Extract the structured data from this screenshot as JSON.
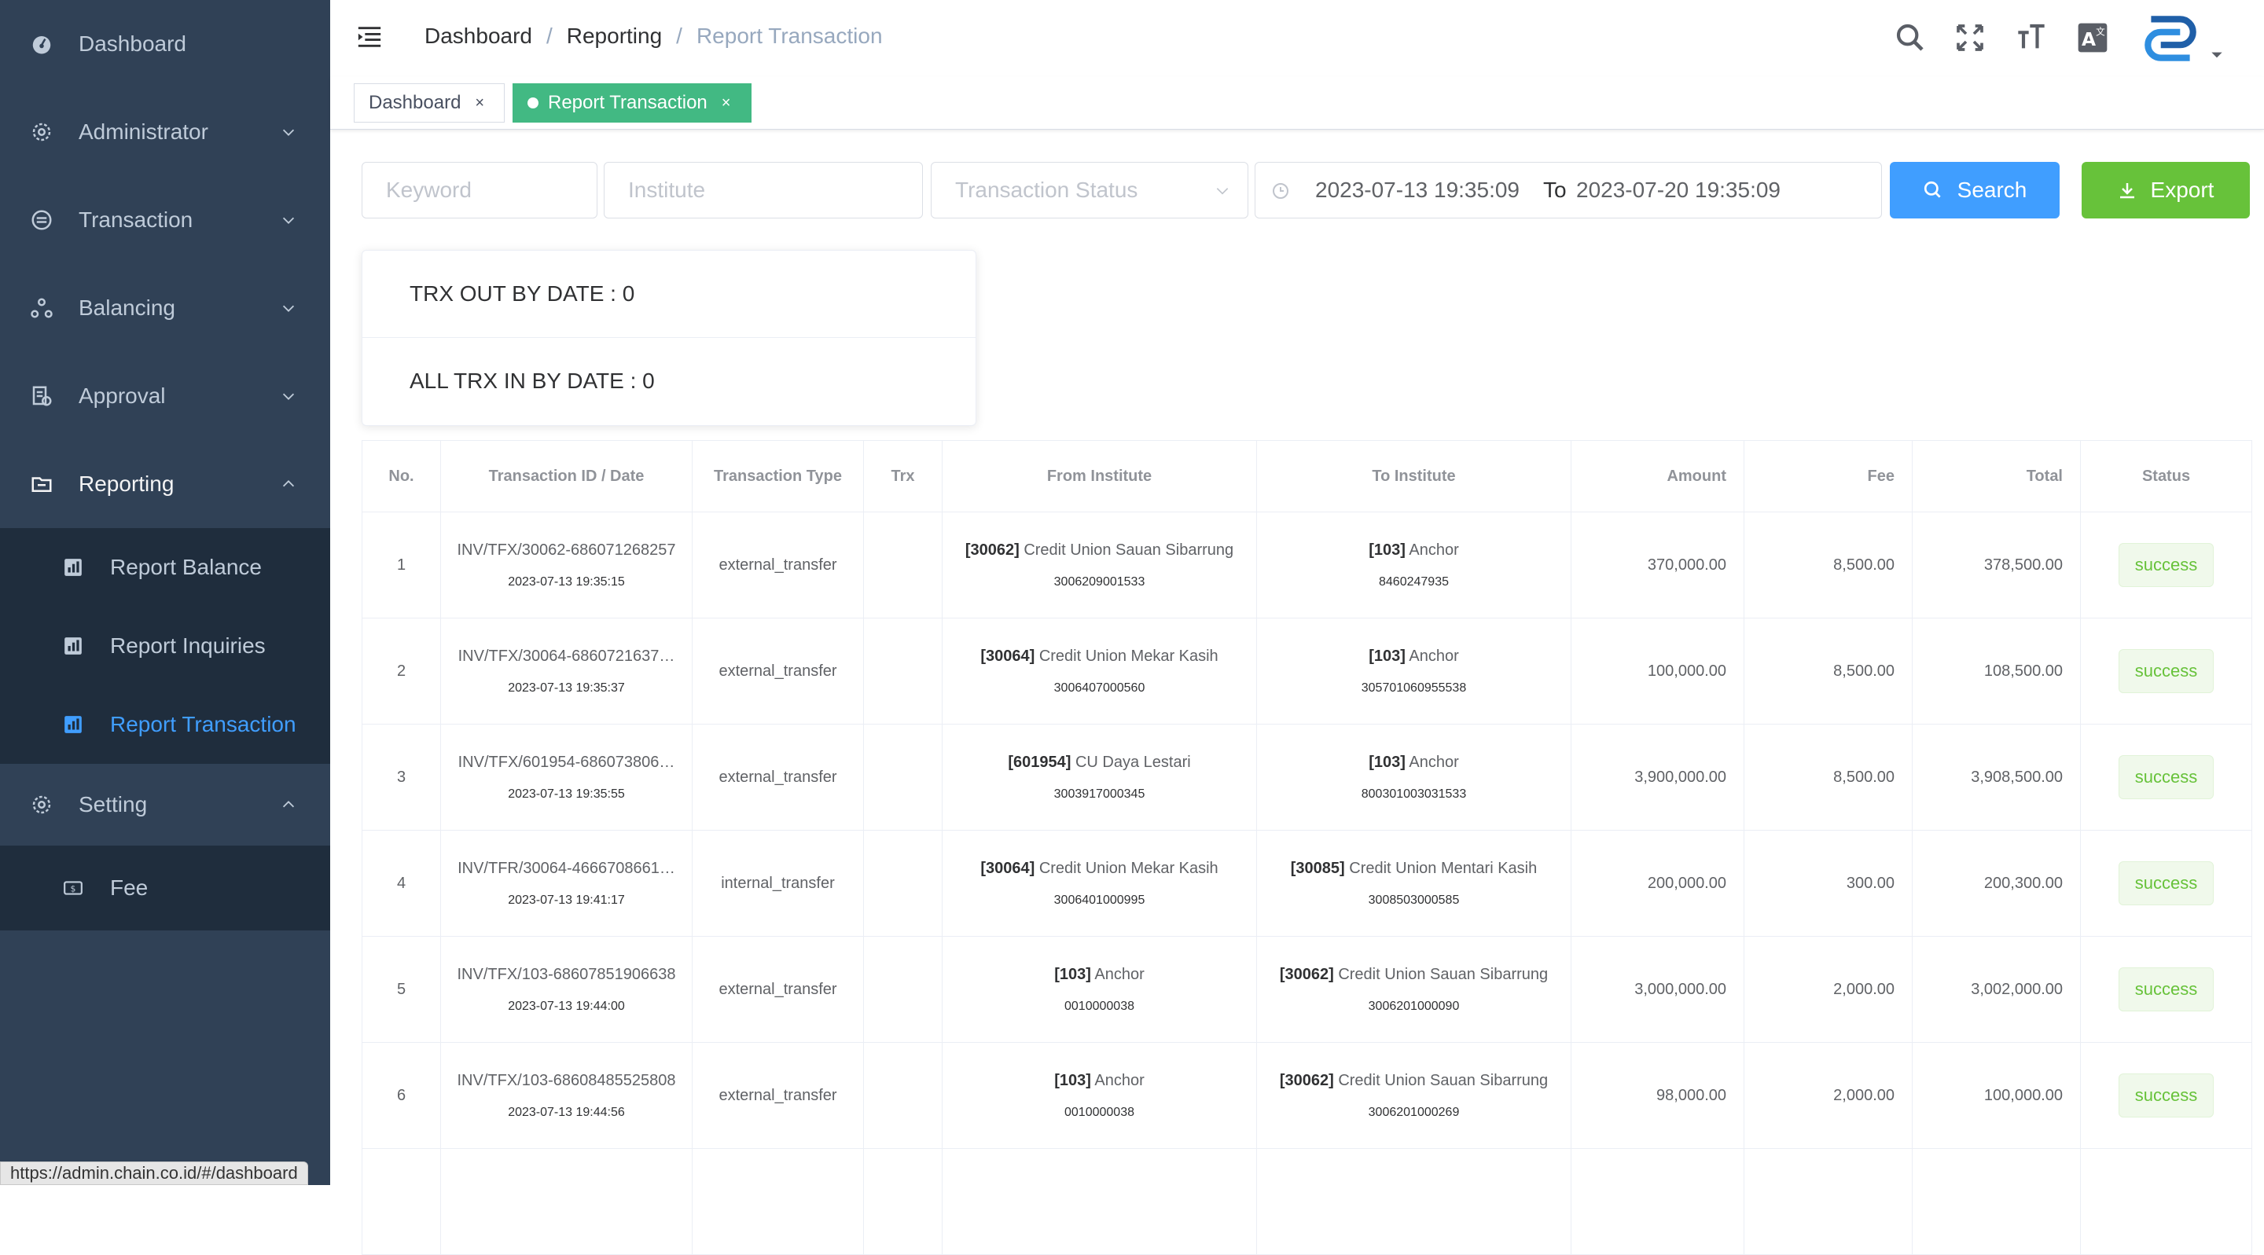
{
  "sidebar": {
    "items": [
      {
        "label": "Dashboard",
        "icon": "dashboard-icon"
      },
      {
        "label": "Administrator",
        "icon": "gear-icon"
      },
      {
        "label": "Transaction",
        "icon": "transaction-icon"
      },
      {
        "label": "Balancing",
        "icon": "balancing-icon"
      },
      {
        "label": "Approval",
        "icon": "approval-icon"
      },
      {
        "label": "Reporting",
        "icon": "folder-icon"
      }
    ],
    "reporting_sub": [
      {
        "label": "Report Balance",
        "icon": "chart-icon"
      },
      {
        "label": "Report Inquiries",
        "icon": "chart-icon"
      },
      {
        "label": "Report Transaction",
        "icon": "chart-icon"
      }
    ],
    "setting": {
      "label": "Setting",
      "icon": "gear-icon"
    },
    "setting_sub": [
      {
        "label": "Fee",
        "icon": "money-icon"
      }
    ],
    "status_url": "https://admin.chain.co.id/#/dashboard"
  },
  "header": {
    "breadcrumb": [
      "Dashboard",
      "Reporting",
      "Report Transaction"
    ],
    "icons": [
      "search-icon",
      "fullscreen-icon",
      "font-size-icon",
      "translate-icon",
      "avatar"
    ]
  },
  "tags": [
    {
      "label": "Dashboard",
      "close": "×"
    },
    {
      "label": "Report Transaction",
      "close": "×"
    }
  ],
  "filters": {
    "keyword_placeholder": "Keyword",
    "institute_placeholder": "Institute",
    "status_placeholder": "Transaction Status",
    "date_from": "2023-07-13 19:35:09",
    "date_sep": "To",
    "date_to": "2023-07-20 19:35:09",
    "search_label": "Search",
    "export_label": "Export"
  },
  "summary": {
    "trx_out": "TRX OUT BY DATE : 0",
    "trx_in": "ALL TRX IN BY DATE : 0"
  },
  "table": {
    "headers": [
      "No.",
      "Transaction ID / Date",
      "Transaction Type",
      "Trx",
      "From Institute",
      "To Institute",
      "Amount",
      "Fee",
      "Total",
      "Status"
    ],
    "rows": [
      {
        "no": "1",
        "id": "INV/TFX/30062-686071268257",
        "date": "2023-07-13 19:35:15",
        "type": "external_transfer",
        "trx": "",
        "from_code": "[30062]",
        "from_name": "Credit Union Sauan Sibarrung",
        "from_acc": "3006209001533",
        "to_code": "[103]",
        "to_name": "Anchor",
        "to_acc": "8460247935",
        "amount": "370,000.00",
        "fee": "8,500.00",
        "total": "378,500.00",
        "status": "success"
      },
      {
        "no": "2",
        "id": "INV/TFX/30064-6860721637…",
        "date": "2023-07-13 19:35:37",
        "type": "external_transfer",
        "trx": "",
        "from_code": "[30064]",
        "from_name": "Credit Union Mekar Kasih",
        "from_acc": "3006407000560",
        "to_code": "[103]",
        "to_name": "Anchor",
        "to_acc": "305701060955538",
        "amount": "100,000.00",
        "fee": "8,500.00",
        "total": "108,500.00",
        "status": "success"
      },
      {
        "no": "3",
        "id": "INV/TFX/601954-686073806…",
        "date": "2023-07-13 19:35:55",
        "type": "external_transfer",
        "trx": "",
        "from_code": "[601954]",
        "from_name": "CU Daya Lestari",
        "from_acc": "3003917000345",
        "to_code": "[103]",
        "to_name": "Anchor",
        "to_acc": "800301003031533",
        "amount": "3,900,000.00",
        "fee": "8,500.00",
        "total": "3,908,500.00",
        "status": "success"
      },
      {
        "no": "4",
        "id": "INV/TFR/30064-4666708661…",
        "date": "2023-07-13 19:41:17",
        "type": "internal_transfer",
        "trx": "",
        "from_code": "[30064]",
        "from_name": "Credit Union Mekar Kasih",
        "from_acc": "3006401000995",
        "to_code": "[30085]",
        "to_name": "Credit Union Mentari Kasih",
        "to_acc": "3008503000585",
        "amount": "200,000.00",
        "fee": "300.00",
        "total": "200,300.00",
        "status": "success"
      },
      {
        "no": "5",
        "id": "INV/TFX/103-68607851906638",
        "date": "2023-07-13 19:44:00",
        "type": "external_transfer",
        "trx": "",
        "from_code": "[103]",
        "from_name": "Anchor",
        "from_acc": "0010000038",
        "to_code": "[30062]",
        "to_name": "Credit Union Sauan Sibarrung",
        "to_acc": "3006201000090",
        "amount": "3,000,000.00",
        "fee": "2,000.00",
        "total": "3,002,000.00",
        "status": "success"
      },
      {
        "no": "6",
        "id": "INV/TFX/103-68608485525808",
        "date": "2023-07-13 19:44:56",
        "type": "external_transfer",
        "trx": "",
        "from_code": "[103]",
        "from_name": "Anchor",
        "from_acc": "0010000038",
        "to_code": "[30062]",
        "to_name": "Credit Union Sauan Sibarrung",
        "to_acc": "3006201000269",
        "amount": "98,000.00",
        "fee": "2,000.00",
        "total": "100,000.00",
        "status": "success"
      }
    ]
  }
}
